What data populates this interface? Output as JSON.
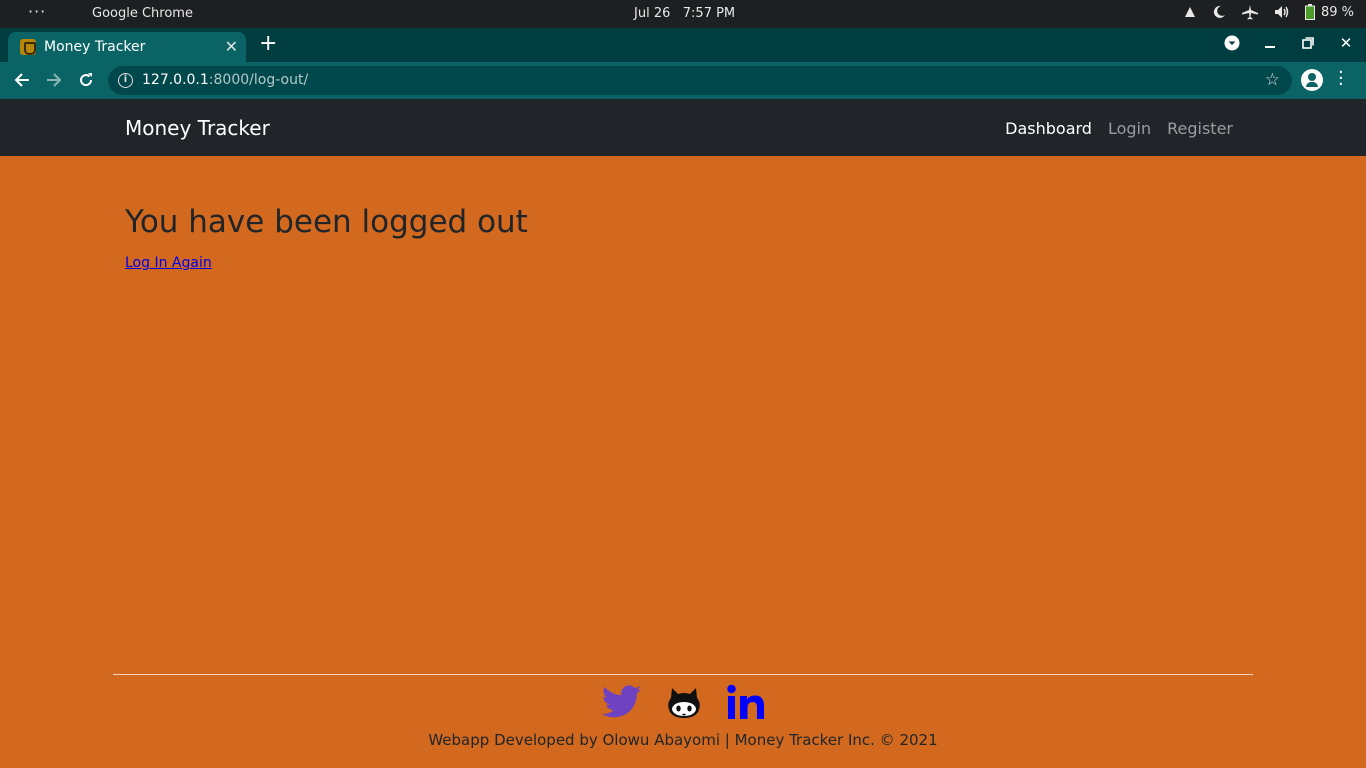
{
  "os": {
    "app_name": "Google Chrome",
    "date": "Jul 26",
    "time": "7:57 PM",
    "battery": "89 %"
  },
  "browser": {
    "tab_title": "Money Tracker",
    "url_host": "127.0.0.1",
    "url_rest": ":8000/log-out/"
  },
  "site": {
    "brand": "Money Tracker",
    "nav": {
      "dashboard": "Dashboard",
      "login": "Login",
      "register": "Register"
    }
  },
  "main": {
    "title": "You have been logged out",
    "relogin_link": "Log In Again"
  },
  "footer": {
    "social": [
      "twitter-icon",
      "github-icon",
      "linkedin-icon"
    ],
    "text": "Webapp Developed by Olowu Abayomi | Money Tracker Inc. © 2021"
  },
  "colors": {
    "page_bg": "#d2691e",
    "navbar_bg": "#212529",
    "chrome_tab_active": "#0a6466",
    "twitter": "#6f42c1",
    "linkedin": "#0000ff"
  }
}
